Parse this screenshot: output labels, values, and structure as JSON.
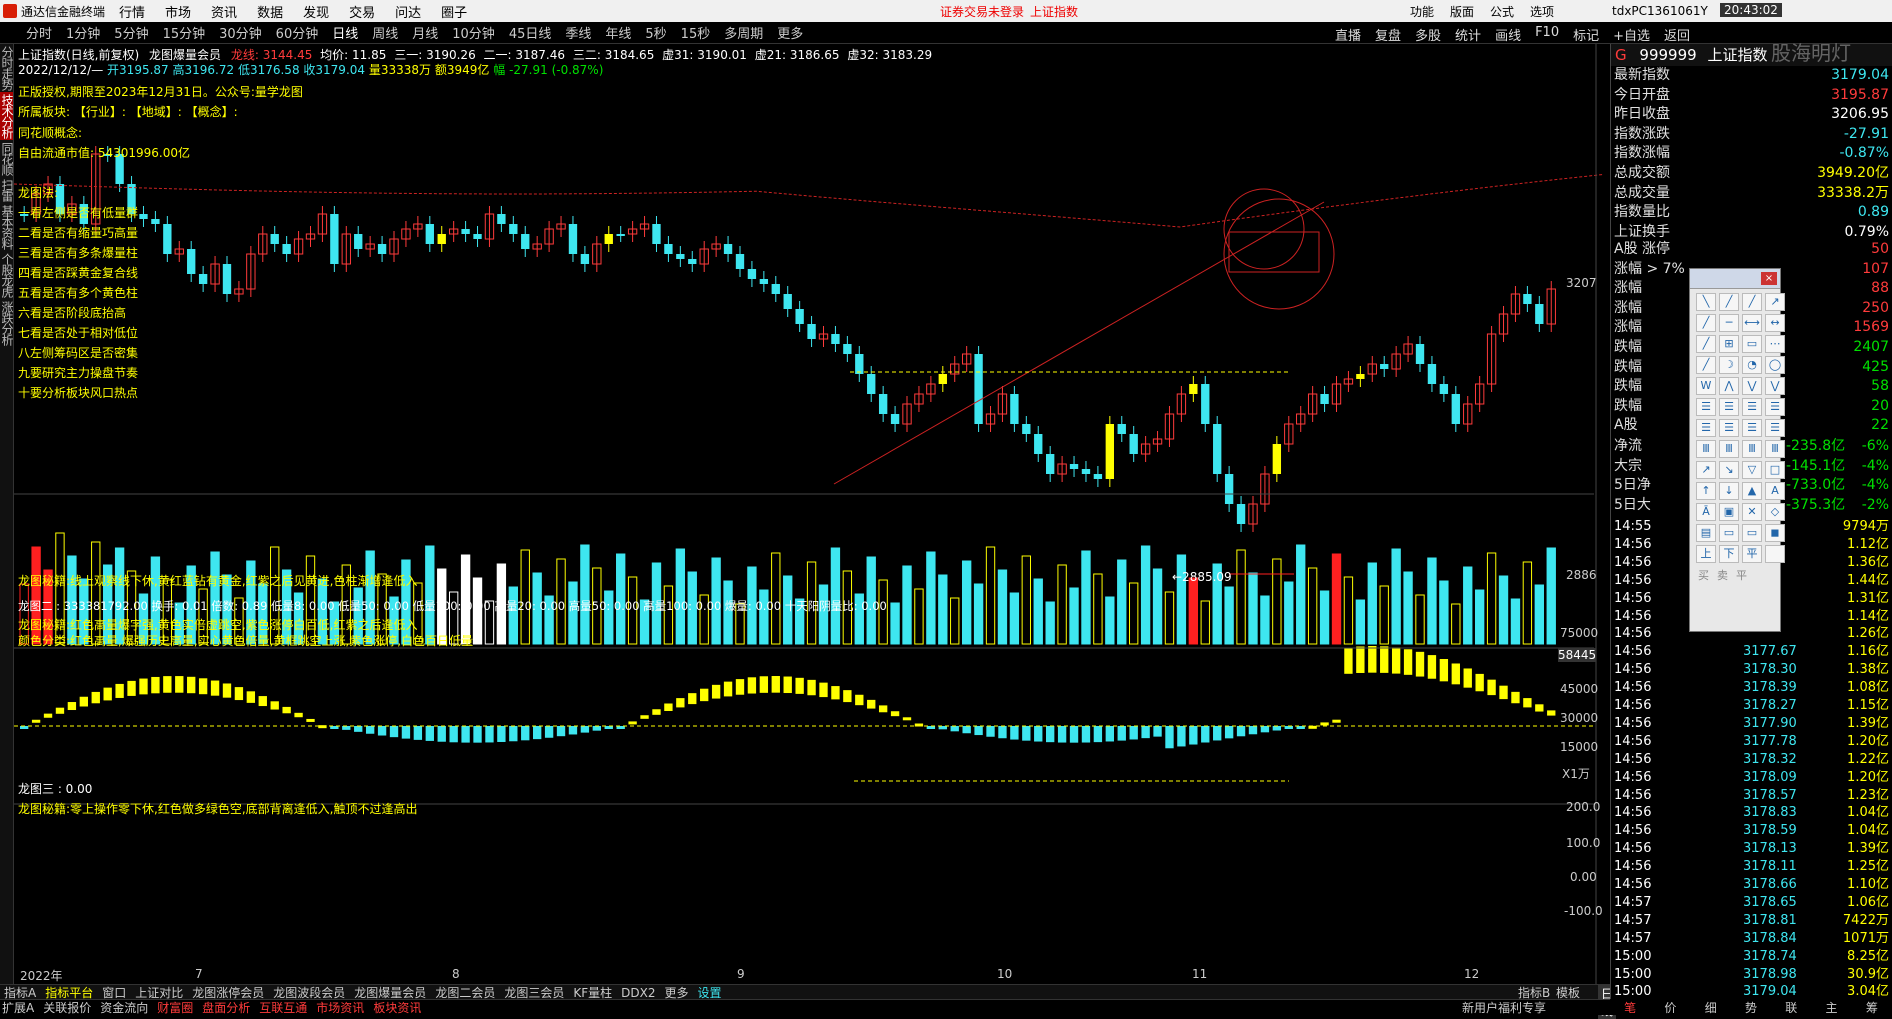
{
  "menubar": {
    "app": "通达信金融终端",
    "menus": [
      "行情",
      "市场",
      "资讯",
      "数据",
      "发现",
      "交易",
      "问达",
      "圈子"
    ],
    "warn1": "证券交易未登录",
    "warn2": "上证指数",
    "right": [
      "功能",
      "版面",
      "公式",
      "选项"
    ],
    "user": "tdxPC1361061Y",
    "clock": "20:43:02"
  },
  "periods": [
    "分时",
    "1分钟",
    "5分钟",
    "15分钟",
    "30分钟",
    "60分钟",
    "日线",
    "周线",
    "月线",
    "10分钟",
    "45日线",
    "季线",
    "年线",
    "5秒",
    "15秒",
    "多周期",
    "更多"
  ],
  "active_period": "日线",
  "toolbar": [
    "直播",
    "复盘",
    "多股",
    "统计",
    "画线",
    "F10",
    "标记",
    "+自选",
    "返回"
  ],
  "leftnav": [
    "分时走势",
    "技术分析",
    "同花顺",
    "扫雷",
    "基本资料",
    "个股龙虎",
    "涨跌分析"
  ],
  "chart_header": {
    "title": "上证指数(日线,前复权)",
    "indicator": "龙图爆量会员",
    "dragon": "龙线: 3144.45",
    "avg": "均价: 11.85",
    "l1": "三一: 3190.26",
    "l2": "二一: 3187.46",
    "l3": "三二: 3184.65",
    "l4": "虚31: 3190.01",
    "l5": "虚21: 3186.65",
    "l6": "虚32: 3183.29",
    "date": "2022/12/12/—",
    "open": "开3195.87",
    "high": "高3196.72",
    "low": "低3176.58",
    "close": "收3179.04",
    "vol": "量33338万",
    "amt": "额3949亿",
    "chg": "幅 -27.91 (-0.87%)"
  },
  "notes": {
    "rights": "正版授权,期限至2023年12月31日。公众号:量学龙图",
    "sector": "所属板块:    【行业】:         【地域】:          【概念】:",
    "ths": "同花顺概念:",
    "mcap": "自由流通市值: 54301996.00亿",
    "dragon_title": "龙图法:",
    "list": [
      "一看左侧是否有低量群",
      "二看是否有缩量巧高量",
      "三看是否有多条爆量柱",
      "四看是否踩黄金复合线",
      "五看是否有多个黄色柱",
      "六看是否阶段底抬高",
      "七看是否处于相对低位",
      "八左侧筹码区是否密集",
      "九要研究主力操盘节奏",
      "十要分析板块风口热点"
    ],
    "tip": "龙图秘籍:线上观察线下休,黄红蓝钻有黄金,红紫之后见黄进,色柱渐增逢低入"
  },
  "main_axis": {
    "top": "3207",
    "bottom": "2886",
    "low_mark": "←2885.09"
  },
  "vol_panel": {
    "header": "龙图二 : 333381792.00 换手: 0.01 倍数: 0.89 低量8: 0.00 低量50: 0.00 低量100: 0.00 高量20: 0.00 高量50: 0.00 高量100: 0.00 爆量: 0.00 十天阳阴量比: 0.00",
    "tip1": "龙图秘籍:红色高量爆字强,黄色实倍虚跳空,紫色涨停白百低,红紫之后逢低入",
    "tip2": "颜色分类:红色高量,爆强历史高量,实心黄色倍量,黄框跳空上涨,紫色涨停,白色百日低量",
    "axis": [
      "75000",
      "58445",
      "45000",
      "30000",
      "15000",
      "X1万"
    ],
    "strong": "强"
  },
  "osc_panel": {
    "header": "龙图三 : 0.00",
    "tip": "龙图秘籍:零上操作零下休,红色做多绿色空,底部背离逢低入,触顶不过逢高出",
    "axis": [
      "200.0",
      "100.0",
      "0.00",
      "-100.0"
    ]
  },
  "date_axis": [
    "2022年",
    "7",
    "8",
    "9",
    "10",
    "11",
    "12"
  ],
  "index_tabs": [
    "指标A",
    "指标平台",
    "窗口",
    "上证对比",
    "龙图涨停会员",
    "龙图波段会员",
    "龙图爆量会员",
    "龙图二会员",
    "龙图三会员",
    "KF量柱",
    "DDX2",
    "更多",
    "设置"
  ],
  "index_tabs_right": [
    "指标B",
    "模板"
  ],
  "bottom_tabs": [
    "扩展A",
    "关联报价",
    "资金流向",
    "财富圈",
    "盘面分析",
    "互联互通",
    "市场资讯",
    "板块资讯"
  ],
  "bottom_right": "新用户福利专享",
  "right_panel": {
    "code": "999999",
    "name": "上证指数",
    "badge": "G",
    "watermark": "股海明灯",
    "stats": [
      {
        "k": "最新指数",
        "v": "3179.04",
        "c": "#3ee6f0"
      },
      {
        "k": "今日开盘",
        "v": "3195.87",
        "c": "#ff3b3b"
      },
      {
        "k": "昨日收盘",
        "v": "3206.95",
        "c": "#ffffff"
      },
      {
        "k": "指数涨跌",
        "v": "-27.91",
        "c": "#3ee6f0"
      },
      {
        "k": "指数涨幅",
        "v": "-0.87%",
        "c": "#3ee6f0"
      },
      {
        "k": "总成交额",
        "v": "3949.20亿",
        "c": "#ffff00"
      },
      {
        "k": "总成交量",
        "v": "33338.2万",
        "c": "#ffff00"
      },
      {
        "k": "指数量比",
        "v": "0.89",
        "c": "#3ee6f0"
      },
      {
        "k": "上证换手",
        "v": "0.79%",
        "c": "#ffffff"
      }
    ],
    "breadth": [
      {
        "k": "A股 涨停",
        "v": "50",
        "c": "#ff3b3b"
      },
      {
        "k": "涨幅 > 7%",
        "v": "107",
        "c": "#ff3b3b"
      },
      {
        "k": "涨幅",
        "v": "88",
        "c": "#ff3b3b"
      },
      {
        "k": "涨幅",
        "v": "250",
        "c": "#ff3b3b"
      },
      {
        "k": "涨幅",
        "v": "1569",
        "c": "#ff3b3b"
      },
      {
        "k": "跌幅",
        "v": "2407",
        "c": "#00e000"
      },
      {
        "k": "跌幅",
        "v": "425",
        "c": "#00e000"
      },
      {
        "k": "跌幅",
        "v": "58",
        "c": "#00e000"
      },
      {
        "k": "跌幅",
        "v": "20",
        "c": "#00e000"
      },
      {
        "k": "A股",
        "v": "22",
        "c": "#00e000"
      }
    ],
    "flow": [
      {
        "k": "净流",
        "v": "-235.8亿",
        "p": "-6%"
      },
      {
        "k": "大宗",
        "v": "-145.1亿",
        "p": "-4%"
      },
      {
        "k": "5日净",
        "v": "-733.0亿",
        "p": "-4%"
      },
      {
        "k": "5日大",
        "v": "-375.3亿",
        "p": "-2%"
      }
    ],
    "ticks": [
      {
        "t": "14:55",
        "p": "",
        "v": "9794万"
      },
      {
        "t": "14:56",
        "p": "",
        "v": "1.12亿"
      },
      {
        "t": "14:56",
        "p": "",
        "v": "1.36亿"
      },
      {
        "t": "14:56",
        "p": "",
        "v": "1.44亿"
      },
      {
        "t": "14:56",
        "p": "",
        "v": "1.31亿"
      },
      {
        "t": "14:56",
        "p": "",
        "v": "1.14亿"
      },
      {
        "t": "14:56",
        "p": "",
        "v": "1.26亿"
      },
      {
        "t": "14:56",
        "p": "3177.67",
        "v": "1.16亿"
      },
      {
        "t": "14:56",
        "p": "3178.30",
        "v": "1.38亿"
      },
      {
        "t": "14:56",
        "p": "3178.39",
        "v": "1.08亿"
      },
      {
        "t": "14:56",
        "p": "3178.27",
        "v": "1.15亿"
      },
      {
        "t": "14:56",
        "p": "3177.90",
        "v": "1.39亿"
      },
      {
        "t": "14:56",
        "p": "3177.78",
        "v": "1.20亿"
      },
      {
        "t": "14:56",
        "p": "3178.32",
        "v": "1.22亿"
      },
      {
        "t": "14:56",
        "p": "3178.09",
        "v": "1.20亿"
      },
      {
        "t": "14:56",
        "p": "3178.57",
        "v": "1.23亿"
      },
      {
        "t": "14:56",
        "p": "3178.83",
        "v": "1.04亿"
      },
      {
        "t": "14:56",
        "p": "3178.59",
        "v": "1.04亿"
      },
      {
        "t": "14:56",
        "p": "3178.13",
        "v": "1.39亿"
      },
      {
        "t": "14:56",
        "p": "3178.11",
        "v": "1.25亿"
      },
      {
        "t": "14:56",
        "p": "3178.66",
        "v": "1.10亿"
      },
      {
        "t": "14:57",
        "p": "3178.65",
        "v": "1.06亿"
      },
      {
        "t": "14:57",
        "p": "3178.81",
        "v": "7422万"
      },
      {
        "t": "14:57",
        "p": "3178.84",
        "v": "1071万"
      },
      {
        "t": "15:00",
        "p": "3178.74",
        "v": "8.25亿"
      },
      {
        "t": "15:00",
        "p": "3178.98",
        "v": "30.9亿"
      },
      {
        "t": "15:00",
        "p": "3179.04",
        "v": "3.04亿"
      }
    ],
    "footer": [
      "笔",
      "价",
      "细",
      "势",
      "联",
      "主",
      "筹"
    ]
  },
  "palette_bottom": [
    "买",
    "卖",
    "平"
  ],
  "colors": {
    "up": "#ff3b3b",
    "down": "#3ee6f0",
    "yellow": "#ffff00",
    "magenta": "#ff40ff",
    "accent": "#d81e06"
  }
}
